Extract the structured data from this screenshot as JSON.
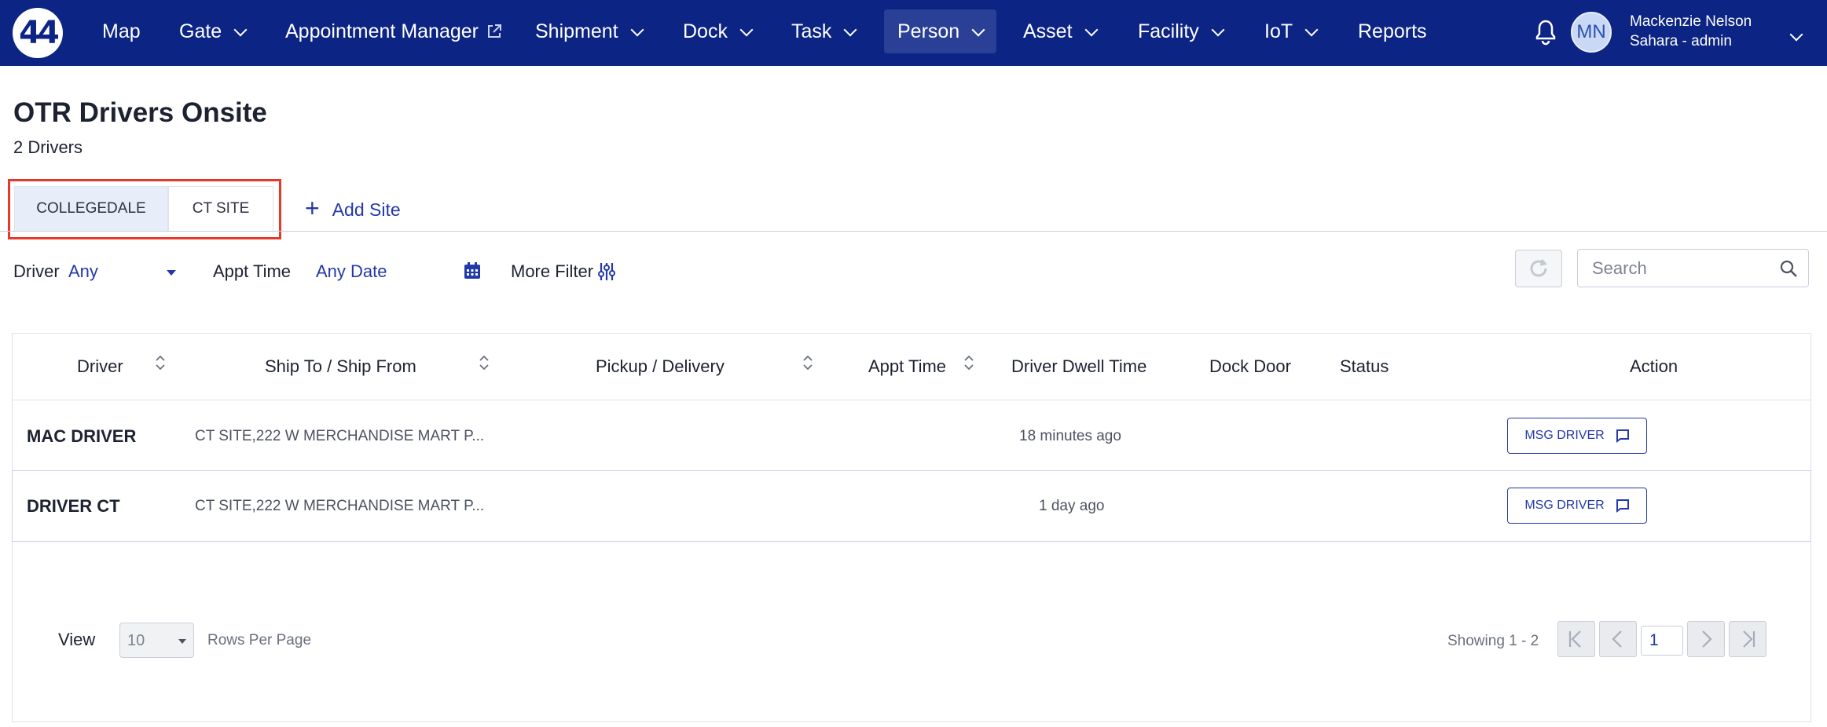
{
  "nav": {
    "logo": "44",
    "items": [
      {
        "label": "Map"
      },
      {
        "label": "Gate"
      },
      {
        "label": "Appointment Manager"
      },
      {
        "label": "Shipment"
      },
      {
        "label": "Dock"
      },
      {
        "label": "Task"
      },
      {
        "label": "Person"
      },
      {
        "label": "Asset"
      },
      {
        "label": "Facility"
      },
      {
        "label": "IoT"
      },
      {
        "label": "Reports"
      }
    ],
    "active": "Person",
    "user": {
      "initials": "MN",
      "name": "Mackenzie Nelson",
      "role": "Sahara - admin"
    }
  },
  "page": {
    "title": "OTR Drivers Onsite",
    "subtitle": "2 Drivers"
  },
  "tabs": [
    {
      "label": "COLLEGEDALE",
      "selected": true
    },
    {
      "label": "CT SITE",
      "selected": false
    }
  ],
  "add_site": "Add Site",
  "filters": {
    "driver_label": "Driver",
    "driver_value": "Any",
    "appt_label": "Appt Time",
    "appt_value": "Any Date",
    "more_filter": "More Filter",
    "search_placeholder": "Search"
  },
  "table": {
    "columns": [
      "Driver",
      "Ship To / Ship From",
      "Pickup / Delivery",
      "Appt Time",
      "Driver Dwell Time",
      "Dock Door",
      "Status",
      "Action"
    ],
    "rows": [
      {
        "driver": "MAC DRIVER",
        "ship": "CT SITE,222 W MERCHANDISE MART P...",
        "pickup": "",
        "appt": "",
        "dwell": "18 minutes ago",
        "dock": "",
        "status": "",
        "action": "MSG DRIVER"
      },
      {
        "driver": "DRIVER CT",
        "ship": "CT SITE,222 W MERCHANDISE MART P...",
        "pickup": "",
        "appt": "",
        "dwell": "1 day ago",
        "dock": "",
        "status": "",
        "action": "MSG DRIVER"
      }
    ]
  },
  "pagination": {
    "view_label": "View",
    "rows_per_page": "10",
    "rows_per_page_label": "Rows Per Page",
    "showing": "Showing 1 - 2",
    "current_page": "1"
  },
  "colors": {
    "nav_bg": "#0c2483",
    "accent": "#2339a8",
    "highlight": "#e8382a"
  }
}
